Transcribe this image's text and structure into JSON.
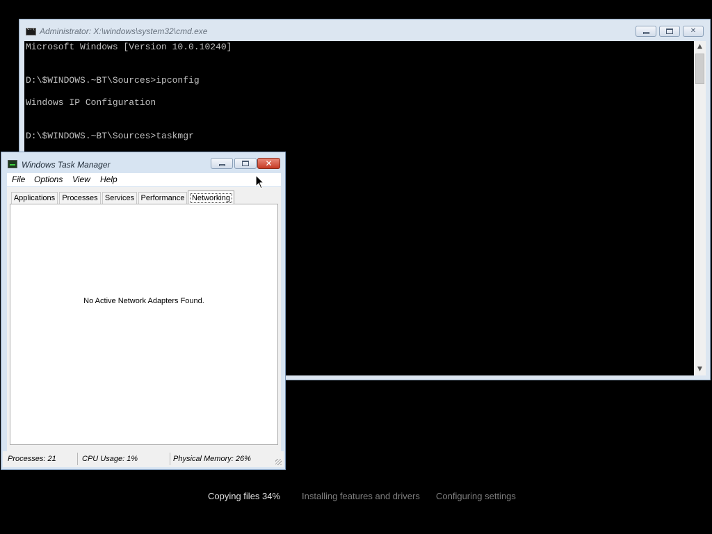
{
  "cmd_window": {
    "title": "Administrator: X:\\windows\\system32\\cmd.exe",
    "lines": [
      "Microsoft Windows [Version 10.0.10240]",
      "D:\\$WINDOWS.~BT\\Sources>ipconfig",
      "Windows IP Configuration",
      "D:\\$WINDOWS.~BT\\Sources>taskmgr"
    ],
    "minimize_glyph": "",
    "maximize_glyph": "",
    "close_glyph": "✕",
    "scroll_up_glyph": "▲",
    "scroll_down_glyph": "▼"
  },
  "task_manager": {
    "title": "Windows Task Manager",
    "close_glyph": "✕",
    "menu": [
      "File",
      "Options",
      "View",
      "Help"
    ],
    "tabs": [
      "Applications",
      "Processes",
      "Services",
      "Performance",
      "Networking"
    ],
    "active_tab": "Networking",
    "message": "No Active Network Adapters Found.",
    "status": {
      "processes": "Processes: 21",
      "cpu": "CPU Usage: 1%",
      "memory": "Physical Memory: 26%"
    }
  },
  "setup_progress": {
    "steps": [
      "Copying files 34%",
      "Installing features and drivers",
      "Configuring settings"
    ],
    "active_step": 0
  },
  "colors": {
    "console_background": "#000000",
    "console_text": "#c0c0c0",
    "window_frame": "#dce6f1",
    "close_button": "#c63a24",
    "setup_active_text": "#e0e0e0",
    "setup_pending_text": "#7e7e7e"
  }
}
